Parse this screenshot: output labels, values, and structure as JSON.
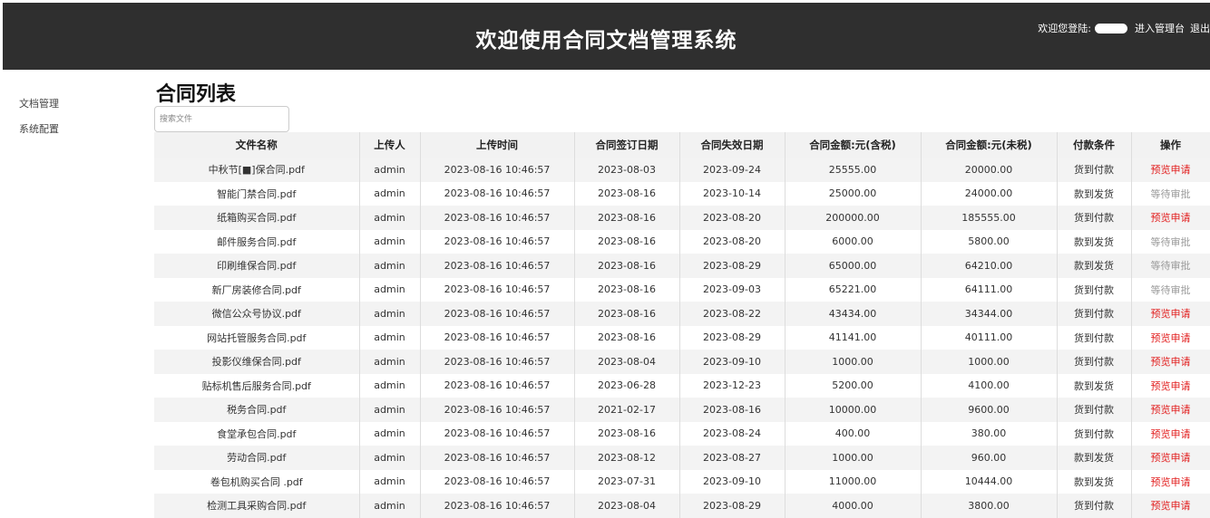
{
  "header": {
    "title": "欢迎使用合同文档管理系统",
    "welcome_label": "欢迎您登陆:",
    "admin_link": "进入管理台",
    "logout_link": "退出"
  },
  "sidebar": {
    "items": [
      {
        "label": "文档管理"
      },
      {
        "label": "系统配置"
      }
    ]
  },
  "main": {
    "title": "合同列表",
    "search_placeholder": "搜索文件"
  },
  "table": {
    "columns": [
      "文件名称",
      "上传人",
      "上传时间",
      "合同签订日期",
      "合同失效日期",
      "合同金额:元(含税)",
      "合同金额:元(未税)",
      "付款条件",
      "操作"
    ],
    "rows": [
      [
        "中秋节[■]保合同.pdf",
        "admin",
        "2023-08-16 10:46:57",
        "2023-08-03",
        "2023-09-24",
        "25555.00",
        "20000.00",
        "货到付款",
        "预览申请"
      ],
      [
        "智能门禁合同.pdf",
        "admin",
        "2023-08-16 10:46:57",
        "2023-08-16",
        "2023-10-14",
        "25000.00",
        "24000.00",
        "款到发货",
        "等待审批"
      ],
      [
        "纸箱购买合同.pdf",
        "admin",
        "2023-08-16 10:46:57",
        "2023-08-16",
        "2023-08-20",
        "200000.00",
        "185555.00",
        "货到付款",
        "预览申请"
      ],
      [
        "邮件服务合同.pdf",
        "admin",
        "2023-08-16 10:46:57",
        "2023-08-16",
        "2023-08-20",
        "6000.00",
        "5800.00",
        "款到发货",
        "等待审批"
      ],
      [
        "印刷维保合同.pdf",
        "admin",
        "2023-08-16 10:46:57",
        "2023-08-16",
        "2023-08-29",
        "65000.00",
        "64210.00",
        "款到发货",
        "等待审批"
      ],
      [
        "新厂房装修合同.pdf",
        "admin",
        "2023-08-16 10:46:57",
        "2023-08-16",
        "2023-09-03",
        "65221.00",
        "64111.00",
        "货到付款",
        "等待审批"
      ],
      [
        "微信公众号协议.pdf",
        "admin",
        "2023-08-16 10:46:57",
        "2023-08-16",
        "2023-08-22",
        "43434.00",
        "34344.00",
        "货到付款",
        "预览申请"
      ],
      [
        "网站托管服务合同.pdf",
        "admin",
        "2023-08-16 10:46:57",
        "2023-08-16",
        "2023-08-29",
        "41141.00",
        "40111.00",
        "货到付款",
        "预览申请"
      ],
      [
        "投影仪维保合同.pdf",
        "admin",
        "2023-08-16 10:46:57",
        "2023-08-04",
        "2023-09-10",
        "1000.00",
        "1000.00",
        "货到付款",
        "预览申请"
      ],
      [
        "贴标机售后服务合同.pdf",
        "admin",
        "2023-08-16 10:46:57",
        "2023-06-28",
        "2023-12-23",
        "5200.00",
        "4100.00",
        "款到发货",
        "预览申请"
      ],
      [
        "税务合同.pdf",
        "admin",
        "2023-08-16 10:46:57",
        "2021-02-17",
        "2023-08-16",
        "10000.00",
        "9600.00",
        "货到付款",
        "预览申请"
      ],
      [
        "食堂承包合同.pdf",
        "admin",
        "2023-08-16 10:46:57",
        "2023-08-16",
        "2023-08-24",
        "400.00",
        "380.00",
        "货到付款",
        "预览申请"
      ],
      [
        "劳动合同.pdf",
        "admin",
        "2023-08-16 10:46:57",
        "2023-08-12",
        "2023-08-27",
        "1000.00",
        "960.00",
        "款到发货",
        "预览申请"
      ],
      [
        "卷包机购买合同 .pdf",
        "admin",
        "2023-08-16 10:46:57",
        "2023-07-31",
        "2023-09-10",
        "11000.00",
        "10444.00",
        "款到发货",
        "预览申请"
      ],
      [
        "检测工具采购合同.pdf",
        "admin",
        "2023-08-16 10:46:57",
        "2023-08-04",
        "2023-08-29",
        "4000.00",
        "3800.00",
        "货到付款",
        "预览申请"
      ]
    ]
  },
  "colors": {
    "header_bg": "#2f2f2f",
    "action_link": "#e21d1d",
    "action_pending": "#9a9a9a"
  }
}
